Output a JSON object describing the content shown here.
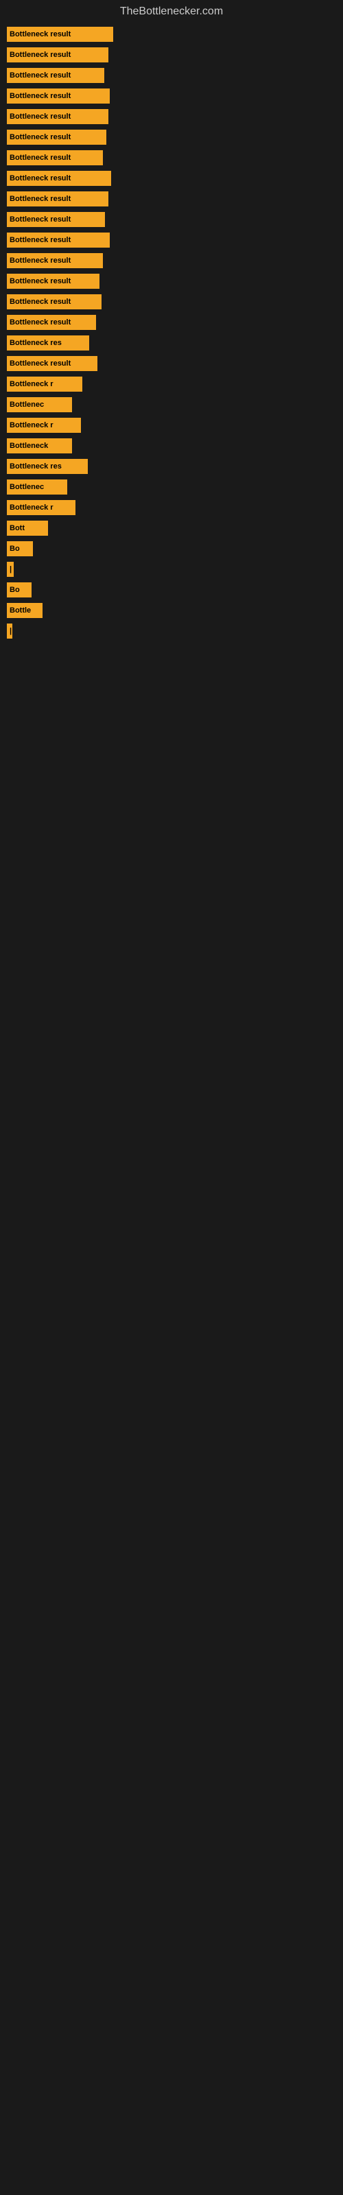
{
  "site": {
    "title": "TheBottlenecker.com"
  },
  "bars": [
    {
      "id": 1,
      "label": "Bottleneck result",
      "width": 155
    },
    {
      "id": 2,
      "label": "Bottleneck result",
      "width": 148
    },
    {
      "id": 3,
      "label": "Bottleneck result",
      "width": 142
    },
    {
      "id": 4,
      "label": "Bottleneck result",
      "width": 150
    },
    {
      "id": 5,
      "label": "Bottleneck result",
      "width": 148
    },
    {
      "id": 6,
      "label": "Bottleneck result",
      "width": 145
    },
    {
      "id": 7,
      "label": "Bottleneck result",
      "width": 140
    },
    {
      "id": 8,
      "label": "Bottleneck result",
      "width": 152
    },
    {
      "id": 9,
      "label": "Bottleneck result",
      "width": 148
    },
    {
      "id": 10,
      "label": "Bottleneck result",
      "width": 143
    },
    {
      "id": 11,
      "label": "Bottleneck result",
      "width": 150
    },
    {
      "id": 12,
      "label": "Bottleneck result",
      "width": 140
    },
    {
      "id": 13,
      "label": "Bottleneck result",
      "width": 135
    },
    {
      "id": 14,
      "label": "Bottleneck result",
      "width": 138
    },
    {
      "id": 15,
      "label": "Bottleneck result",
      "width": 130
    },
    {
      "id": 16,
      "label": "Bottleneck res",
      "width": 120
    },
    {
      "id": 17,
      "label": "Bottleneck result",
      "width": 132
    },
    {
      "id": 18,
      "label": "Bottleneck r",
      "width": 110
    },
    {
      "id": 19,
      "label": "Bottlenec",
      "width": 95
    },
    {
      "id": 20,
      "label": "Bottleneck r",
      "width": 108
    },
    {
      "id": 21,
      "label": "Bottleneck",
      "width": 95
    },
    {
      "id": 22,
      "label": "Bottleneck res",
      "width": 118
    },
    {
      "id": 23,
      "label": "Bottlenec",
      "width": 88
    },
    {
      "id": 24,
      "label": "Bottleneck r",
      "width": 100
    },
    {
      "id": 25,
      "label": "Bott",
      "width": 60
    },
    {
      "id": 26,
      "label": "Bo",
      "width": 38
    },
    {
      "id": 27,
      "label": "|",
      "width": 10
    },
    {
      "id": 28,
      "label": "Bo",
      "width": 36
    },
    {
      "id": 29,
      "label": "Bottle",
      "width": 52
    },
    {
      "id": 30,
      "label": "|",
      "width": 8
    }
  ]
}
